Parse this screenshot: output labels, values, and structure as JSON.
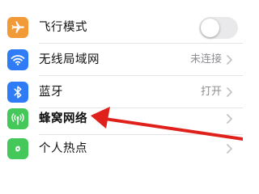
{
  "settings": {
    "rows": [
      {
        "label": "飞行模式",
        "icon": "airplane-icon",
        "icon_color": "#f29a38",
        "control": "toggle",
        "toggle_on": false
      },
      {
        "label": "无线局域网",
        "icon": "wifi-icon",
        "icon_color": "#2f7cf6",
        "value": "未连接"
      },
      {
        "label": "蓝牙",
        "icon": "bluetooth-icon",
        "icon_color": "#2f7cf6",
        "value": "打开"
      },
      {
        "label": "蜂窝网络",
        "icon": "cellular-antenna-icon",
        "icon_color": "#43c859"
      },
      {
        "label": "个人热点",
        "icon": "personal-hotspot-icon",
        "icon_color": "#43c859"
      }
    ]
  },
  "annotation": {
    "type": "red-arrow",
    "color": "#e0201b",
    "points_to": "蜂窝网络"
  }
}
